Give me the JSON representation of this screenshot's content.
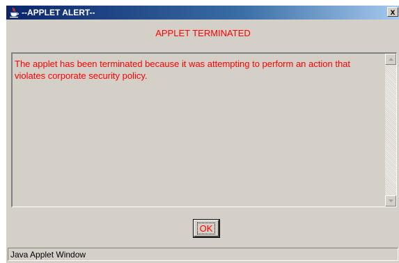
{
  "window": {
    "title": "--APPLET ALERT--",
    "close_label": "x",
    "icon": "java-cup-icon"
  },
  "alert": {
    "heading": "APPLET TERMINATED",
    "message": "The applet has been terminated because it was attempting to perform an action that violates corporate security policy."
  },
  "buttons": {
    "ok_label": "OK"
  },
  "status_bar": {
    "text": "Java Applet Window"
  },
  "colors": {
    "alert_text": "#ff0000",
    "dialog_background": "#d4d0c8",
    "titlebar_start": "#0a246a",
    "titlebar_end": "#a6caf0"
  }
}
